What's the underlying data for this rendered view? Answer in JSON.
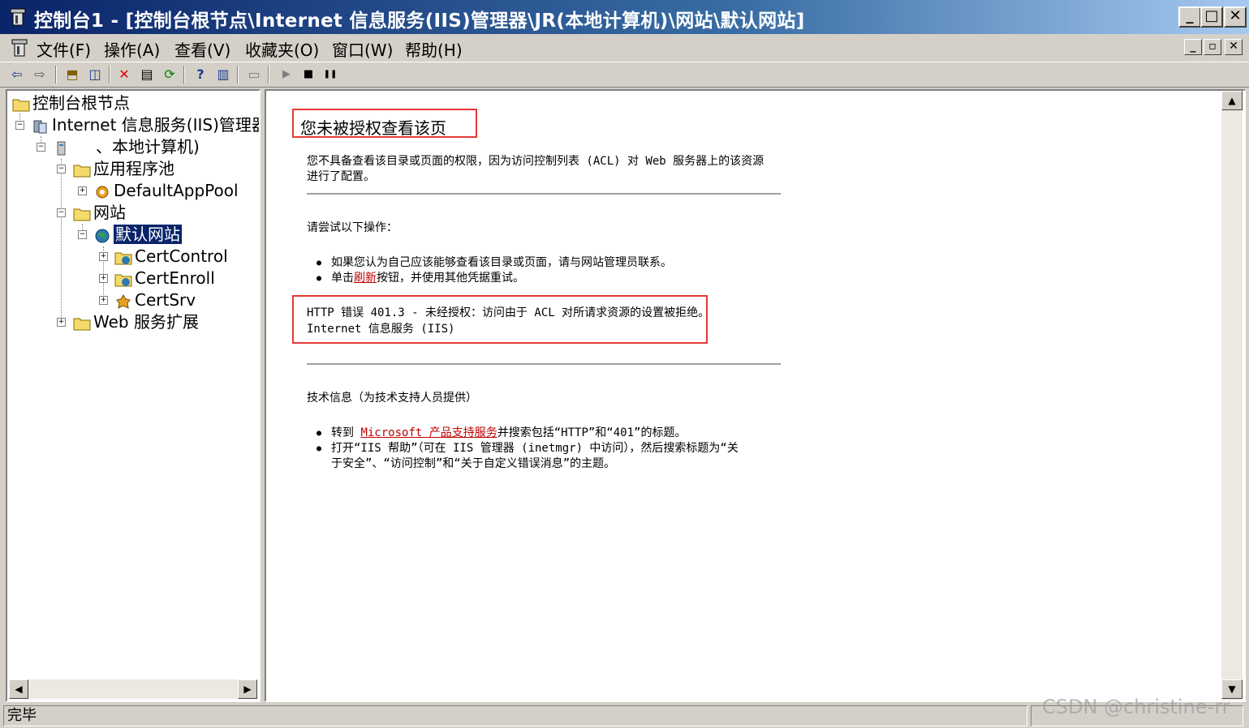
{
  "window": {
    "title": "控制台1 - [控制台根节点\\Internet 信息服务(IIS)管理器\\JR(本地计算机)\\网站\\默认网站]",
    "minimize": "_",
    "maximize": "□",
    "close": "✕"
  },
  "menubar": {
    "items": [
      "文件(F)",
      "操作(A)",
      "查看(V)",
      "收藏夹(O)",
      "窗口(W)",
      "帮助(H)"
    ],
    "mdi_minimize": "_",
    "mdi_restore": "▫",
    "mdi_close": "✕"
  },
  "toolbar": {
    "back": "⇦",
    "forward": "⇨",
    "up": "⬒",
    "show_tree": "◫",
    "delete": "✕",
    "properties": "▤",
    "refresh": "⟳",
    "help": "?",
    "console": "▥",
    "computer": "▭",
    "play": "▶",
    "stop": "■",
    "pause": "❚❚"
  },
  "tree": {
    "root": "控制台根节点",
    "iis": "Internet 信息服务(IIS)管理器",
    "computer": "、本地计算机)",
    "app_pools": "应用程序池",
    "default_app_pool": "DefaultAppPool",
    "websites": "网站",
    "default_site": "默认网站",
    "cert_control": "CertControl",
    "cert_enroll": "CertEnroll",
    "cert_srv": "CertSrv",
    "web_ext": "Web 服务扩展"
  },
  "page": {
    "title": "您未被授权查看该页",
    "desc_line1": "您不具备查看该目录或页面的权限，因为访问控制列表 (ACL) 对 Web 服务器上的该资源",
    "desc_line2": "进行了配置。",
    "try_heading": "请尝试以下操作：",
    "bullet1": "如果您认为自己应该能够查看该目录或页面，请与网站管理员联系。",
    "bullet2_prefix": "单击",
    "bullet2_link": "刷新",
    "bullet2_suffix": "按钮，并使用其他凭据重试。",
    "error_line1": "HTTP 错误 401.3 - 未经授权：访问由于 ACL 对所请求资源的设置被拒绝。",
    "error_line2": "Internet 信息服务 (IIS)",
    "tech_heading": "技术信息（为技术支持人员提供）",
    "tech1_prefix": "转到 ",
    "tech1_link": "Microsoft 产品支持服务",
    "tech1_suffix": "并搜索包括“HTTP”和“401”的标题。",
    "tech2_line1": "打开“IIS 帮助”（可在 IIS 管理器 (inetmgr) 中访问），然后搜索标题为“关",
    "tech2_line2": "于安全”、“访问控制”和“关于自定义错误消息”的主题。"
  },
  "status": {
    "text": "完毕"
  },
  "watermark": "CSDN @christine-rr",
  "colors": {
    "title_start": "#0a246a",
    "title_end": "#a6caf0",
    "highlight_box": "#e53935",
    "link": "#c00000"
  }
}
